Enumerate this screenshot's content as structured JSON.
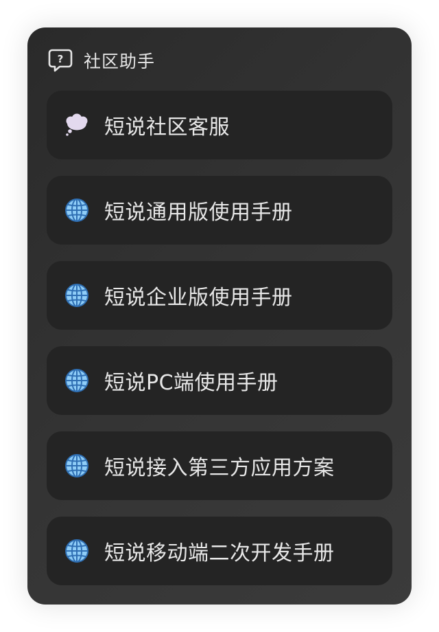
{
  "panel": {
    "title": "社区助手",
    "icon": "question-bubble-icon"
  },
  "items": [
    {
      "label": "短说社区客服",
      "icon": "thought-bubble-icon"
    },
    {
      "label": "短说通用版使用手册",
      "icon": "globe-icon"
    },
    {
      "label": "短说企业版使用手册",
      "icon": "globe-icon"
    },
    {
      "label": "短说PC端使用手册",
      "icon": "globe-icon"
    },
    {
      "label": "短说接入第三方应用方案",
      "icon": "globe-icon"
    },
    {
      "label": "短说移动端二次开发手册",
      "icon": "globe-icon"
    }
  ],
  "colors": {
    "panel_background": "#333333",
    "item_background": "#242424",
    "text": "#e8e8e8",
    "globe_fill": "#8fcdf7",
    "globe_stroke": "#2f6fb3",
    "thought_fill": "#e3d9ee"
  }
}
